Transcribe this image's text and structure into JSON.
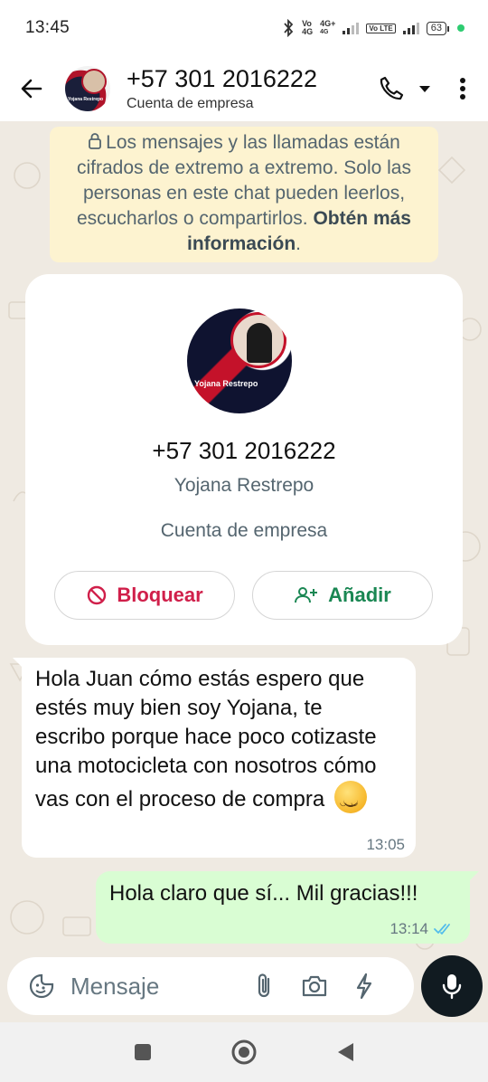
{
  "status_bar": {
    "time": "13:45",
    "volte_1": "Vo",
    "network_1": "4G",
    "network_2_top": "4G+",
    "network_2_bottom": "4G",
    "volte_2": "Vo LTE",
    "battery": "63"
  },
  "header": {
    "title": "+57 301 2016222",
    "subtitle": "Cuenta de empresa",
    "avatar_caption": "Yojana Restrepo"
  },
  "encryption_notice": {
    "text": "Los mensajes y las llamadas están cifrados de extremo a extremo. Solo las personas en este chat pueden leerlos, escucharlos o compartirlos.",
    "link": "Obtén más información",
    "link_suffix": "."
  },
  "profile_card": {
    "avatar_caption": "Yojana Restrepo",
    "phone": "+57 301 2016222",
    "name": "Yojana Restrepo",
    "account_type": "Cuenta de empresa",
    "block_label": "Bloquear",
    "add_label": "Añadir"
  },
  "messages": [
    {
      "direction": "incoming",
      "text": "Hola Juan cómo estás espero que estés muy bien soy Yojana, te escribo porque hace poco cotizaste una motocicleta con nosotros cómo vas con el proceso de compra",
      "emoji": "smiling-face",
      "time": "13:05"
    },
    {
      "direction": "outgoing",
      "text": "Hola claro que sí... Mil gracias!!!",
      "time": "13:14",
      "status": "read"
    }
  ],
  "composer": {
    "placeholder": "Mensaje"
  },
  "colors": {
    "chat_background": "#efeae2",
    "outgoing_bubble": "#d9fdd3",
    "notice_background": "#fdf3d0",
    "block_red": "#d01f4a",
    "add_green": "#1a8753",
    "read_ticks": "#53bdeb"
  },
  "icons": [
    "back-arrow-icon",
    "phone-icon",
    "dropdown-icon",
    "more-vert-icon",
    "lock-icon",
    "block-icon",
    "add-contact-icon",
    "emoji-sticker-icon",
    "attach-icon",
    "camera-icon",
    "lightning-icon",
    "mic-icon",
    "double-check-icon"
  ]
}
